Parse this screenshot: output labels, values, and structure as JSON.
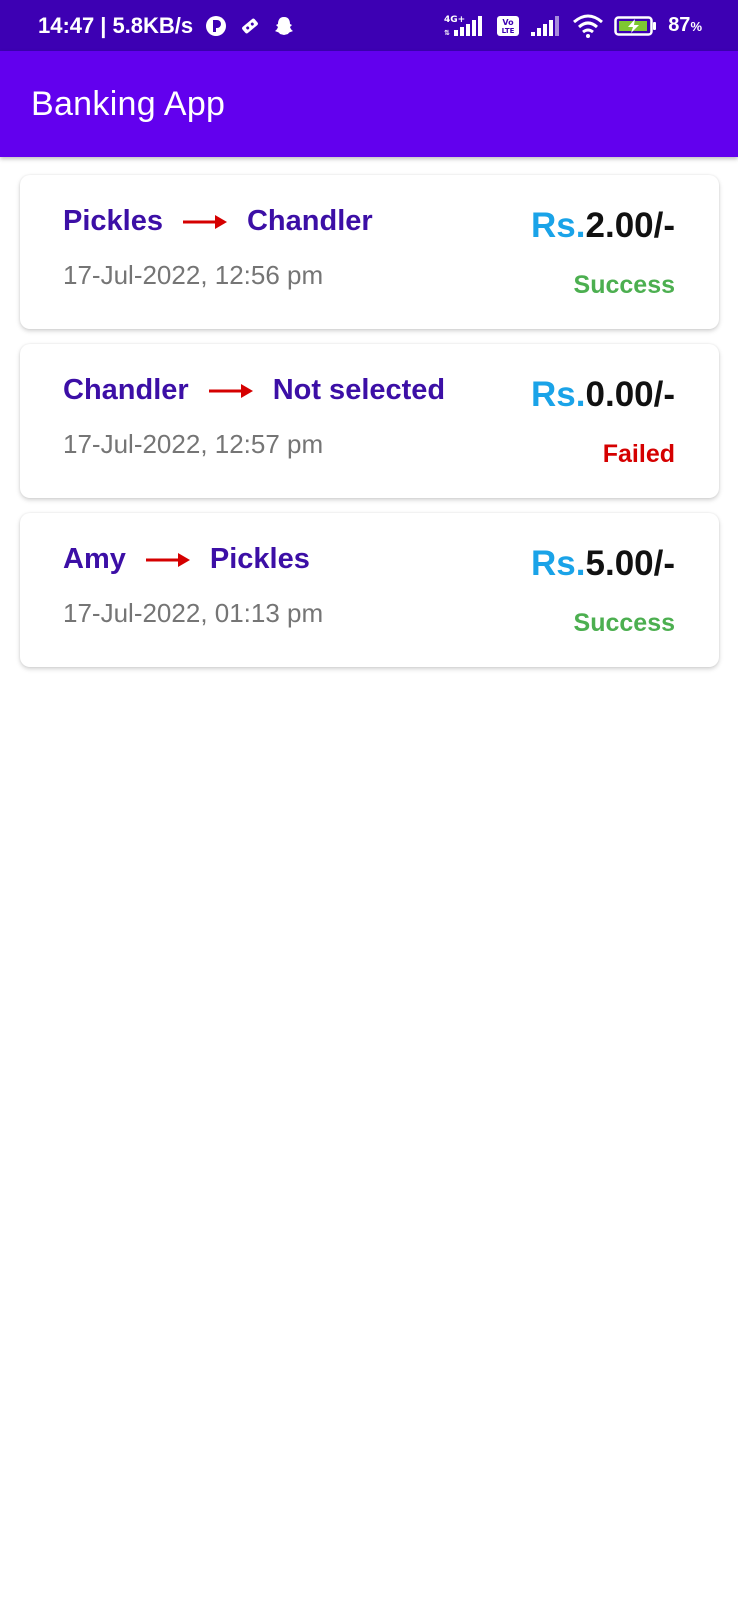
{
  "status_bar": {
    "time": "14:47",
    "separator": "|",
    "net_speed": "5.8KB/s",
    "network_label": "4G+",
    "volte_label": "Vo LTE",
    "battery_percent": "87",
    "battery_unit": "%"
  },
  "app_bar": {
    "title": "Banking App"
  },
  "transactions": [
    {
      "from": "Pickles",
      "to": "Chandler",
      "date": "17-Jul-2022, 12:56 pm",
      "currency": "Rs.",
      "amount": "2.00/-",
      "status": "Success"
    },
    {
      "from": "Chandler",
      "to": "Not selected",
      "date": "17-Jul-2022, 12:57 pm",
      "currency": "Rs.",
      "amount": "0.00/-",
      "status": "Failed"
    },
    {
      "from": "Amy",
      "to": "Pickles",
      "date": "17-Jul-2022, 01:13 pm",
      "currency": "Rs.",
      "amount": "5.00/-",
      "status": "Success"
    }
  ],
  "colors": {
    "status_bar": "#3d00b3",
    "app_bar": "#6200ee",
    "name_text": "#3c0fa6",
    "arrow": "#d50000",
    "currency": "#1aa3e8",
    "success": "#4caf50",
    "failed": "#d50000"
  },
  "icons": {
    "status_left": [
      "data-saver-icon",
      "puzzle-icon",
      "snapchat-ghost-icon"
    ],
    "status_right": [
      "signal-4g-icon",
      "volte-icon",
      "signal-icon",
      "wifi-icon",
      "battery-charging-icon"
    ],
    "transfer": "arrow-right-icon"
  }
}
